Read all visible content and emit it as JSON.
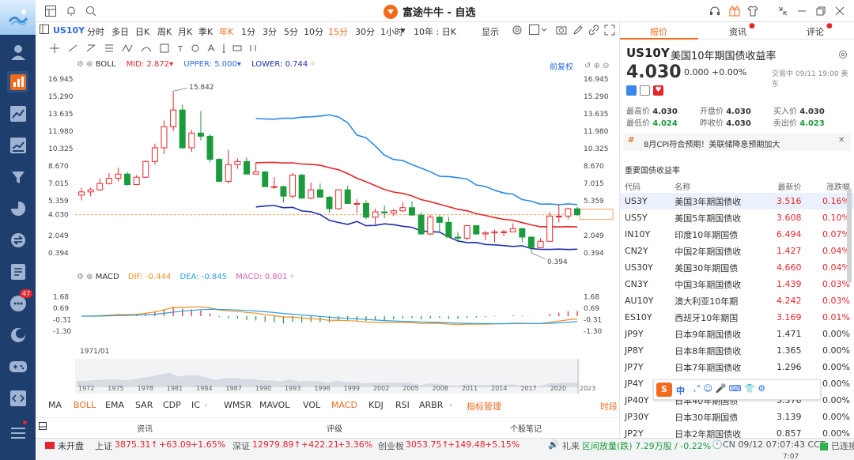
{
  "app": {
    "title": "富途牛牛 - 自选"
  },
  "timeframes": [
    "分时",
    "多日",
    "日K",
    "周K",
    "月K",
    "季K",
    "年K",
    "1分",
    "3分",
    "5分",
    "10分",
    "15分",
    "30分",
    "1小时"
  ],
  "timeframe_active": "年K",
  "timeframe_highlight": "15分",
  "symbol": "US10Y",
  "period_select": "10年 : 日K",
  "display_label": "显示",
  "boll": {
    "label": "BOLL",
    "mid_label": "MID:",
    "mid": "2.872",
    "upper_label": "UPPER:",
    "upper": "5.000",
    "lower_label": "LOWER:",
    "lower": "0.744"
  },
  "adjust_label": "前复权",
  "price_axis": [
    "16.945",
    "15.290",
    "13.635",
    "11.980",
    "10.325",
    "8.670",
    "7.015",
    "5.359",
    "4.030",
    "2.049",
    "0.394"
  ],
  "high_label": "15.842",
  "low_label": "0.394",
  "macd": {
    "label": "MACD",
    "dif_label": "DIF:",
    "dif": "-0.444",
    "dea_label": "DEA:",
    "dea": "-0.845",
    "macd_label": "MACD:",
    "macd": "0.801"
  },
  "macd_axis": [
    "1.68",
    "0.69",
    "-0.31",
    "-1.30"
  ],
  "start_date": "1971/01",
  "years": [
    "1972",
    "1975",
    "1978",
    "1981",
    "1984",
    "1987",
    "1990",
    "1993",
    "1996",
    "1999",
    "2002",
    "2005",
    "2008",
    "2011",
    "2014",
    "2017",
    "2020",
    "2023"
  ],
  "indicators": [
    "MA",
    "BOLL",
    "EMA",
    "SAR",
    "CDP",
    "IC",
    "WMSR",
    "MAVOL",
    "VOL",
    "MACD",
    "KDJ",
    "RSI",
    "ARBR"
  ],
  "indicator_mgmt": "指标管理",
  "indicator_right": "时段",
  "subtabs": [
    "资讯",
    "评级",
    "个股笔记"
  ],
  "right_tabs": [
    "报价",
    "资讯",
    "评论"
  ],
  "quote": {
    "code": "US10Y",
    "name": "美国10年期国债收益率",
    "price": "4.030",
    "change": "0.000",
    "pct": "+0.00%",
    "status": "交易中 09/11 19:00 美东",
    "high_label": "最高价",
    "high": "4.030",
    "low_label": "最低价",
    "low": "4.024",
    "open_label": "开盘价",
    "open": "4.030",
    "prev_label": "昨收价",
    "prev": "4.030",
    "bid_label": "买入价",
    "bid": "4.030",
    "ask_label": "卖出价",
    "ask": "4.023"
  },
  "news": "8月CPI符合预期！美联储降息预期加大",
  "bond_title": "重要国债收益率",
  "bond_headers": [
    "代码",
    "名称",
    "最新价",
    "涨跌幅"
  ],
  "bonds": [
    {
      "code": "US3Y",
      "name": "美国3年期国债收",
      "price": "3.516",
      "pct": "0.16%"
    },
    {
      "code": "US5Y",
      "name": "美国5年期国债收",
      "price": "3.608",
      "pct": "0.10%"
    },
    {
      "code": "IN10Y",
      "name": "印度10年期国债",
      "price": "6.494",
      "pct": "0.07%"
    },
    {
      "code": "CN2Y",
      "name": "中国2年期国债收",
      "price": "1.427",
      "pct": "0.04%"
    },
    {
      "code": "US30Y",
      "name": "美国30年期国债",
      "price": "4.660",
      "pct": "0.04%"
    },
    {
      "code": "CN3Y",
      "name": "中国3年期国债收",
      "price": "1.439",
      "pct": "0.03%"
    },
    {
      "code": "AU10Y",
      "name": "澳大利亚10年期",
      "price": "4.242",
      "pct": "0.03%"
    },
    {
      "code": "ES10Y",
      "name": "西班牙10年期国",
      "price": "3.169",
      "pct": "0.01%"
    },
    {
      "code": "JP9Y",
      "name": "日本9年期国债收",
      "price": "1.471",
      "pct": "0.00%"
    },
    {
      "code": "JP8Y",
      "name": "日本8年期国债收",
      "price": "1.365",
      "pct": "0.00%"
    },
    {
      "code": "JP7Y",
      "name": "日本7年期国债收",
      "price": "1.296",
      "pct": "0.00%"
    },
    {
      "code": "JP4Y",
      "name": "日本4年期国债收",
      "price": "1.099",
      "pct": "0.00%"
    },
    {
      "code": "JP40Y",
      "name": "日本40年期国债",
      "price": "3.376",
      "pct": "0.00%"
    },
    {
      "code": "JP30Y",
      "name": "日本30年期国债",
      "price": "3.139",
      "pct": "0.00%"
    },
    {
      "code": "JP2Y",
      "name": "日本2年期国债收",
      "price": "0.857",
      "pct": "0.00%"
    }
  ],
  "ime": {
    "label": "中"
  },
  "status": {
    "market": "未开盘",
    "sh_label": "上证",
    "sh": "3875.31↑",
    "sh_chg": "+63.09",
    "sh_pct": "+1.65%",
    "sz_label": "深证",
    "sz": "12979.89↑",
    "sz_chg": "+422.21",
    "sz_pct": "+3.36%",
    "cy_label": "创业板",
    "cy": "3053.75↑",
    "cy_chg": "+149.48",
    "cy_pct": "+5.15%",
    "gift": "礼来",
    "range": "区间放量(跌) 7.29万股 / -0.22%",
    "time": "CN 09/12 07:07:43 CCT",
    "conn": "已连接"
  },
  "sidebar_badge": "47",
  "clock": "7:07",
  "chart_data": {
    "type": "candlestick",
    "x": [
      "1971",
      "1972",
      "1973",
      "1974",
      "1975",
      "1976",
      "1977",
      "1978",
      "1979",
      "1980",
      "1981",
      "1982",
      "1983",
      "1984",
      "1985",
      "1986",
      "1987",
      "1988",
      "1989",
      "1990",
      "1991",
      "1992",
      "1993",
      "1994",
      "1995",
      "1996",
      "1997",
      "1998",
      "1999",
      "2000",
      "2001",
      "2002",
      "2003",
      "2004",
      "2005",
      "2006",
      "2007",
      "2008",
      "2009",
      "2010",
      "2011",
      "2012",
      "2013",
      "2014",
      "2015",
      "2016",
      "2017",
      "2018",
      "2019",
      "2020",
      "2021",
      "2022",
      "2023",
      "2024",
      "2025"
    ],
    "ohlc": [
      [
        5.9,
        6.6,
        5.4,
        6.2
      ],
      [
        6.2,
        6.6,
        5.8,
        6.4
      ],
      [
        6.4,
        7.5,
        6.3,
        7.0
      ],
      [
        7.0,
        8.0,
        6.9,
        7.5
      ],
      [
        7.5,
        8.5,
        7.2,
        7.9
      ],
      [
        7.9,
        8.1,
        6.8,
        6.9
      ],
      [
        6.9,
        7.8,
        6.9,
        7.6
      ],
      [
        7.6,
        9.2,
        7.5,
        9.1
      ],
      [
        9.1,
        10.8,
        8.8,
        10.4
      ],
      [
        10.4,
        13.0,
        9.8,
        12.4
      ],
      [
        12.4,
        15.8,
        12.0,
        14.0
      ],
      [
        14.0,
        14.5,
        10.3,
        10.4
      ],
      [
        10.4,
        12.1,
        10.0,
        11.8
      ],
      [
        11.8,
        13.9,
        11.1,
        11.5
      ],
      [
        11.5,
        11.7,
        9.0,
        9.3
      ],
      [
        9.3,
        9.4,
        7.2,
        7.2
      ],
      [
        7.2,
        10.2,
        7.0,
        8.8
      ],
      [
        8.8,
        9.4,
        8.4,
        9.1
      ],
      [
        9.1,
        9.5,
        7.9,
        7.9
      ],
      [
        7.9,
        9.0,
        7.9,
        8.1
      ],
      [
        8.1,
        8.2,
        6.7,
        6.7
      ],
      [
        6.7,
        7.6,
        6.5,
        6.7
      ],
      [
        6.7,
        6.8,
        5.2,
        5.8
      ],
      [
        5.8,
        8.0,
        5.6,
        7.8
      ],
      [
        7.8,
        7.9,
        5.6,
        5.6
      ],
      [
        5.6,
        7.1,
        5.5,
        6.4
      ],
      [
        6.4,
        7.0,
        5.7,
        5.7
      ],
      [
        5.7,
        5.8,
        4.2,
        4.6
      ],
      [
        4.6,
        6.4,
        4.5,
        6.4
      ],
      [
        6.4,
        6.8,
        5.1,
        5.1
      ],
      [
        5.1,
        5.5,
        4.2,
        5.1
      ],
      [
        5.1,
        5.4,
        3.6,
        3.8
      ],
      [
        3.8,
        4.6,
        3.1,
        4.3
      ],
      [
        4.3,
        4.9,
        3.7,
        4.2
      ],
      [
        4.2,
        4.6,
        3.9,
        4.4
      ],
      [
        4.4,
        5.2,
        4.3,
        4.7
      ],
      [
        4.7,
        5.3,
        3.9,
        4.0
      ],
      [
        4.0,
        4.3,
        2.1,
        2.2
      ],
      [
        2.2,
        4.0,
        2.1,
        3.8
      ],
      [
        3.8,
        4.0,
        2.4,
        3.3
      ],
      [
        3.3,
        3.8,
        1.9,
        1.9
      ],
      [
        1.9,
        2.4,
        1.4,
        1.8
      ],
      [
        1.8,
        3.0,
        1.6,
        3.0
      ],
      [
        3.0,
        3.0,
        2.1,
        2.2
      ],
      [
        2.2,
        2.5,
        1.6,
        2.3
      ],
      [
        2.3,
        2.6,
        1.4,
        2.4
      ],
      [
        2.4,
        2.6,
        2.0,
        2.4
      ],
      [
        2.4,
        3.2,
        2.4,
        2.7
      ],
      [
        2.7,
        2.8,
        1.4,
        1.9
      ],
      [
        1.9,
        1.9,
        0.4,
        0.9
      ],
      [
        0.9,
        1.8,
        0.9,
        1.5
      ],
      [
        1.5,
        4.3,
        1.5,
        3.9
      ],
      [
        3.9,
        5.0,
        3.3,
        3.9
      ],
      [
        3.9,
        4.7,
        3.6,
        4.6
      ],
      [
        4.6,
        4.8,
        3.9,
        4.03
      ]
    ],
    "boll_mid_range": [
      6.0,
      2.872
    ],
    "ylim": [
      0.394,
      16.945
    ]
  }
}
